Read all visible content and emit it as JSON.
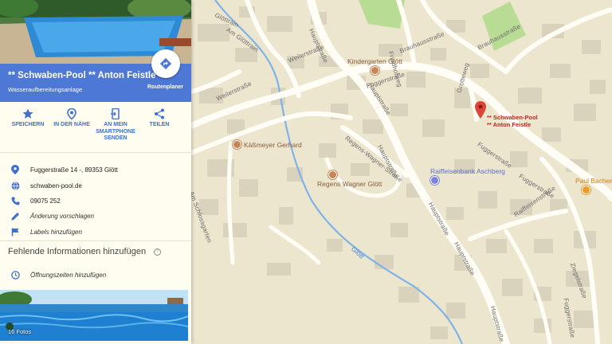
{
  "place": {
    "title": "** Schwaben-Pool ** Anton Feistle",
    "category": "Wasseraufbereitungsanlage",
    "route_label": "Routenplaner"
  },
  "actions": [
    {
      "label_line1": "SPEICHERN",
      "label_line2": "",
      "label_line3": "",
      "icon": "star-icon"
    },
    {
      "label_line1": "IN DER NÄHE",
      "label_line2": "",
      "label_line3": "",
      "icon": "nearby-icon"
    },
    {
      "label_line1": "AN MEIN",
      "label_line2": "SMARTPHONE",
      "label_line3": "SENDEN",
      "icon": "phone-send-icon"
    },
    {
      "label_line1": "TEILEN",
      "label_line2": "",
      "label_line3": "",
      "icon": "share-icon"
    }
  ],
  "info": {
    "address": "Fuggerstraße 14 -, 89353 Glött",
    "website": "schwaben-pool.de",
    "phone": "09075 252",
    "suggest_edit": "Änderung vorschlagen",
    "add_label": "Labels hinzufügen"
  },
  "missing": {
    "title": "Fehlende Informationen hinzufügen",
    "help": "?",
    "hours": "Öffnungszeiten hinzufügen"
  },
  "photos": {
    "count": "16 Fotos"
  },
  "map": {
    "colors": {
      "land": "#ede6cf",
      "road": "#fffdf5",
      "building": "#d9d2bd",
      "park": "#b9dc95",
      "river": "#7fb2e8",
      "panel_header": "#4e78d6",
      "pin": "#db4437"
    },
    "streets": {
      "glottrain": "Glöttrain",
      "am_glottrain": "Am Glöttrain",
      "weilerstr1": "Weilerstraße",
      "weilerstr2": "Weilerstraße",
      "hauptstr1": "Hauptstraße",
      "hauptstr2": "Hauptstraße",
      "hauptstr3": "Hauptstraße",
      "hauptstr4": "Hauptstraße",
      "hauptstr5": "Hauptstraße",
      "hauptstr6": "Hauptstraße",
      "fuggerstr1": "Fuggerstraße",
      "fuggerstr2": "Fuggerstraße",
      "fuggerstr3": "Fuggerstraße",
      "fuggerstr4": "Fuggerstraße",
      "brauhausstr1": "Brauhausstraße",
      "brauhausstr2": "Brauhausstraße",
      "friedhofweg": "Friedhofweg",
      "grotteweg": "Grotteweg",
      "regens_wagner_str": "Regens-Wagner-Straße",
      "am_schlossgarten": "Am Schlossgarten",
      "raiffeisenstr": "Raiffeisenstraße",
      "ziegelstr": "Ziegelstraße",
      "river_name": "Glött"
    },
    "pois": {
      "kindergarten": "Kindergarten Glött",
      "kassmeyer": "Käßmeyer Gerhard",
      "regens_wagner": "Regens Wagner Glött",
      "raiffeisenbank": "Raiffeisenbank Aschberg",
      "paul_bacherl": "Paul Bacherl"
    },
    "pin_label_line1": "** Schwaben-Pool",
    "pin_label_line2": "** Anton Feistle"
  }
}
